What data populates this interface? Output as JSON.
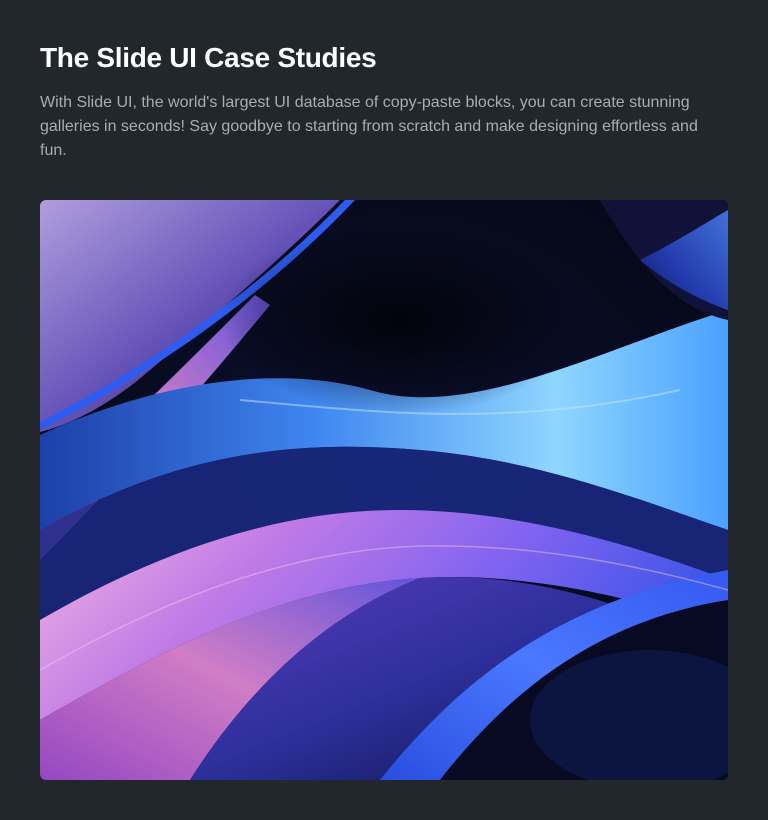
{
  "header": {
    "title": "The Slide UI Case Studies",
    "description": "With Slide UI, the world's largest UI database of copy-paste blocks, you can create stunning galleries in seconds! Say goodbye to starting from scratch and make designing effortless and fun."
  },
  "gallery": {
    "image_subject": "abstract-blue-purple-waves"
  },
  "colors": {
    "page_background": "#22272b",
    "title_text": "#ffffff",
    "body_text": "#a8adb3",
    "wave_blue": "#3a6df0",
    "wave_cyan": "#7fd0ff",
    "wave_pink": "#e6a0e6",
    "wave_purple": "#8a5ae0"
  }
}
